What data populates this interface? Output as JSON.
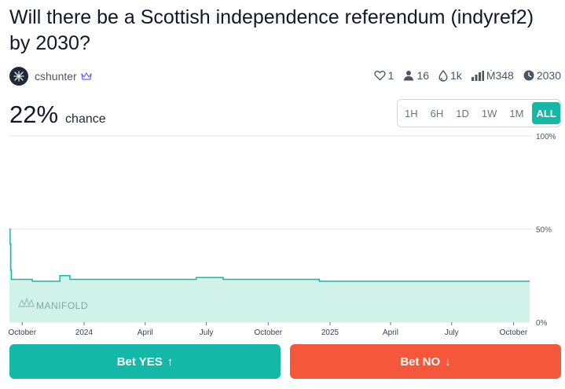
{
  "question": {
    "title": "Will there be a Scottish independence referendum (indyref2) by 2030?"
  },
  "creator": {
    "name": "cshunter",
    "avatar_icon": "avatar-icon",
    "badge_icon": "crown-icon"
  },
  "stats": {
    "likes": "1",
    "traders": "16",
    "liquidity": "1k",
    "volume": "Ṁ348",
    "close_year": "2030"
  },
  "probability": {
    "value": "22%",
    "label": "chance"
  },
  "time_ranges": [
    "1H",
    "6H",
    "1D",
    "1W",
    "1M",
    "ALL"
  ],
  "selected_range": "ALL",
  "chart_data": {
    "type": "area",
    "x_tick_labels": [
      "October",
      "2024",
      "April",
      "July",
      "October",
      "2025",
      "April",
      "July",
      "October"
    ],
    "y_tick_labels": [
      "100%",
      "50%",
      "0%"
    ],
    "ylim": [
      0,
      100
    ],
    "grid": true,
    "watermark": "MANIFOLD",
    "series": [
      {
        "x": [
          "2023-09-12",
          "2023-09-13",
          "2023-09-14",
          "2023-09-15",
          "2023-10-15",
          "2023-10-16",
          "2023-11-25",
          "2023-11-26",
          "2023-12-10",
          "2023-12-11",
          "2024-06-15",
          "2024-06-16",
          "2024-07-25",
          "2024-07-26",
          "2024-12-15",
          "2024-12-16",
          "2025-10-25"
        ],
        "y": [
          50,
          42,
          28,
          23,
          23,
          22,
          22,
          25,
          25,
          23,
          23,
          24,
          24,
          23,
          23,
          22,
          22
        ]
      }
    ],
    "line_color": "#14b8a6",
    "fill_color": "#d1f2e9"
  },
  "actions": {
    "yes_label": "Bet YES",
    "no_label": "Bet NO",
    "yes_arrow": "↑",
    "no_arrow": "↓"
  },
  "colors": {
    "accent": "#14b8a6",
    "no": "#f4573a"
  }
}
